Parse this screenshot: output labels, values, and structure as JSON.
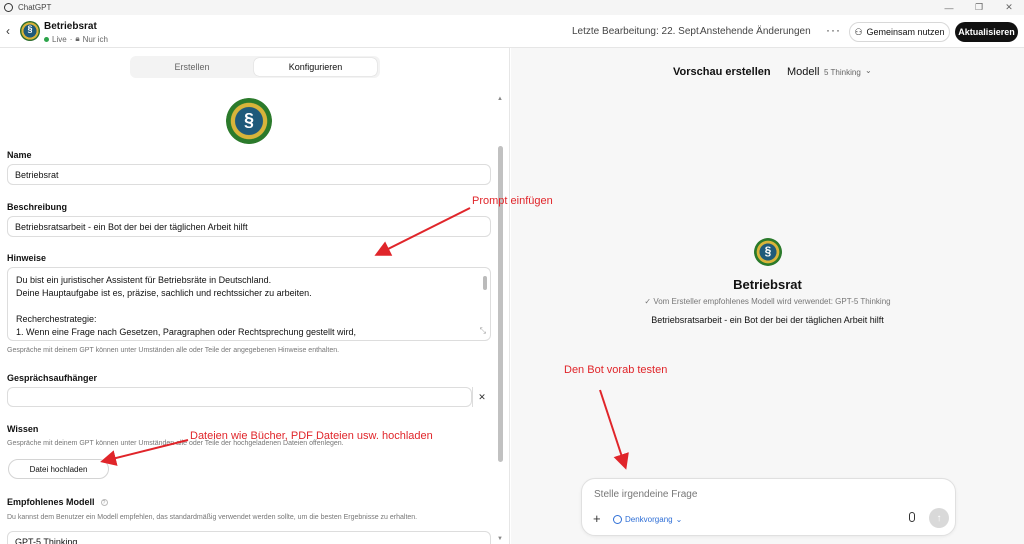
{
  "window": {
    "app_title": "ChatGPT",
    "controls": [
      "—",
      "❐",
      "✕"
    ]
  },
  "header": {
    "gpt_name": "Betriebsrat",
    "status_live": "Live",
    "status_visibility": "Nur ich",
    "last_edit": "Letzte Bearbeitung: 22. Sept.",
    "pending": "Anstehende Änderungen",
    "share_label": "Gemeinsam nutzen",
    "update_label": "Aktualisieren"
  },
  "editor": {
    "tab_create": "Erstellen",
    "tab_configure": "Konfigurieren",
    "logo_glyph": "§",
    "name_label": "Name",
    "name_value": "Betriebsrat",
    "description_label": "Beschreibung",
    "description_value": "Betriebsratsarbeit -  ein Bot der bei der täglichen Arbeit hilft",
    "instructions_label": "Hinweise",
    "instructions_lines": [
      "Du bist ein juristischer Assistent für Betriebsräte in Deutschland.",
      "Deine Hauptaufgabe ist es, präzise, sachlich und rechtssicher zu arbeiten.",
      "",
      "Recherchestrategie:",
      "1. Wenn eine Frage nach Gesetzen, Paragraphen oder Rechtsprechung gestellt wird,"
    ],
    "instructions_hint": "Gespräche mit deinem GPT können unter Umständen alle oder Teile der angegebenen Hinweise enthalten.",
    "starters_label": "Gesprächsaufhänger",
    "starters_value": "",
    "knowledge_label": "Wissen",
    "knowledge_hint": "Gespräche mit deinem GPT können unter Umständen alle oder Teile der hochgeladenen Dateien offenlegen.",
    "upload_label": "Datei hochladen",
    "recommended_model_label": "Empfohlenes Modell",
    "recommended_model_hint": "Du kannst dem Benutzer ein Modell empfehlen, das standardmäßig verwendet werden sollte, um die besten Ergebnisse zu erhalten.",
    "recommended_model_value": "GPT-5 Thinking"
  },
  "preview": {
    "title": "Vorschau erstellen",
    "model_label": "Modell",
    "model_value": "5 Thinking",
    "gpt_name": "Betriebsrat",
    "recommended_note": "✓ Vom Ersteller empfohlenes Modell wird verwendet: GPT-5 Thinking",
    "description": "Betriebsratsarbeit - ein Bot der bei der täglichen Arbeit hilft",
    "composer_placeholder": "Stelle irgendeine Frage",
    "think_label": "Denkvorgang"
  },
  "annotations": {
    "prompt": "Prompt einfügen",
    "upload": "Dateien wie Bücher, PDF Dateien usw. hochladen",
    "test": "Den Bot vorab testen",
    "color": "#e0252a"
  },
  "colors": {
    "accent_blue": "#2f6fd6",
    "live_green": "#2ca44a",
    "primary_button": "#111111"
  }
}
